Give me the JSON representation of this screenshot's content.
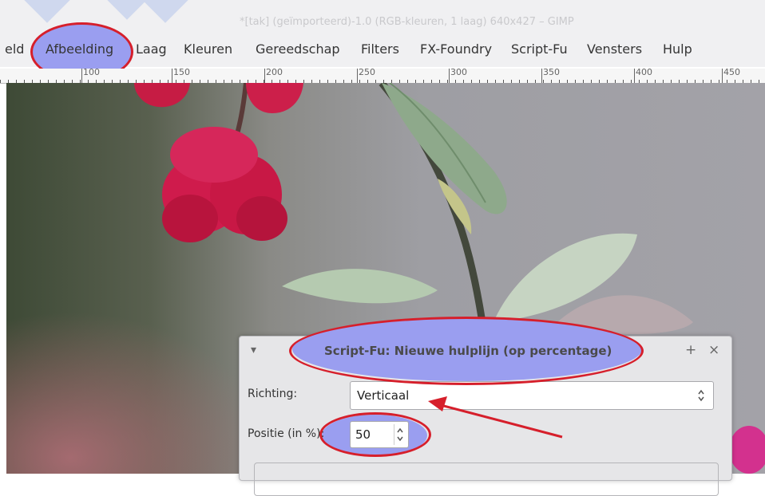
{
  "window": {
    "title": "*[tak] (geïmporteerd)-1.0 (RGB-kleuren, 1 laag) 640x427 – GIMP"
  },
  "menubar": {
    "items": [
      {
        "label": "eld"
      },
      {
        "label": "Afbeelding"
      },
      {
        "label": "Laag"
      },
      {
        "label": "Kleuren"
      },
      {
        "label": "Gereedschap"
      },
      {
        "label": "Filters"
      },
      {
        "label": "FX-Foundry"
      },
      {
        "label": "Script-Fu"
      },
      {
        "label": "Vensters"
      },
      {
        "label": "Hulp"
      }
    ]
  },
  "ruler": {
    "labels": [
      "100",
      "150",
      "200",
      "250",
      "300",
      "350",
      "400",
      "450"
    ]
  },
  "dialog": {
    "title": "Script-Fu: Nieuwe hulplijn (op percentage)",
    "menu_glyph": "▾",
    "add_glyph": "+",
    "close_glyph": "×",
    "direction_label": "Richting:",
    "direction_value": "Verticaal",
    "position_label": "Positie (in %):",
    "position_value": "50"
  },
  "colors": {
    "annotation_red": "#d61f2b",
    "annotation_fill": "#9a9ef0",
    "flower_pink": "#d21a4f",
    "leaf_green": "#8aa68a"
  }
}
